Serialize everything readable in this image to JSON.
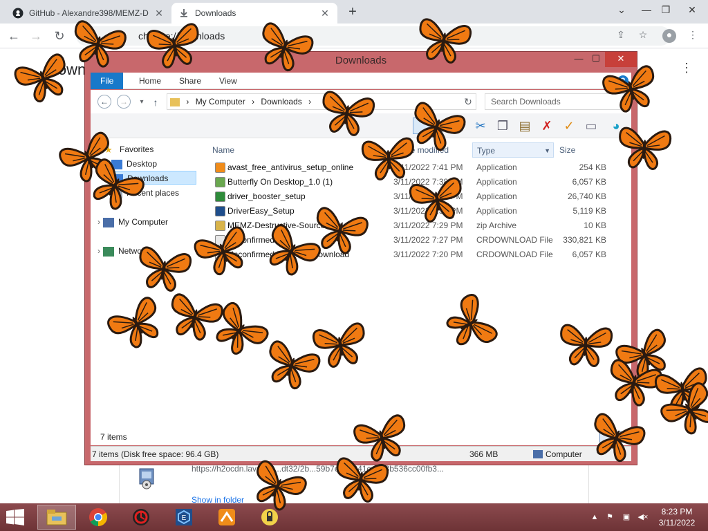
{
  "browser": {
    "tabs": [
      {
        "title": "GitHub - Alexandre398/MEMZ-D",
        "close": "✕",
        "icon": "github-icon"
      },
      {
        "title": "Downloads",
        "close": "✕",
        "icon": "download-icon"
      }
    ],
    "new_tab": "+",
    "window_controls": {
      "chevron": "⌄",
      "minimize": "—",
      "restore": "❐",
      "close": "✕"
    },
    "omnibox_text": "chrome://downloads",
    "page_title": "Downloads",
    "download_item": {
      "url": "https://h2ocdn.lavasoft...dt32/2b...59b7e7d2041ce9e3b536cc00fb3...",
      "action": "Show in folder"
    }
  },
  "explorer": {
    "title": "Downloads",
    "controls": {
      "minimize": "—",
      "maximize": "☐",
      "close": "✕"
    },
    "ribbon_tabs": [
      "File",
      "Home",
      "Share",
      "View"
    ],
    "help": "?",
    "breadcrumb": [
      "My Computer",
      "Downloads"
    ],
    "search_placeholder": "Search Downloads",
    "nav": {
      "favorites": "Favorites",
      "desktop": "Desktop",
      "downloads": "Downloads",
      "recent": "Recent places",
      "my_computer": "My Computer",
      "network": "Network"
    },
    "columns": {
      "name": "Name",
      "date": "Date modified",
      "type": "Type",
      "size": "Size"
    },
    "files": [
      {
        "name": "avast_free_antivirus_setup_online",
        "date": "3/11/2022 7:41 PM",
        "type": "Application",
        "size": "254 KB",
        "color": "#f08c1a"
      },
      {
        "name": "Butterfly On Desktop_1.0 (1)",
        "date": "3/11/2022 7:38 PM",
        "type": "Application",
        "size": "6,057 KB",
        "color": "#6aa84f"
      },
      {
        "name": "driver_booster_setup",
        "date": "3/11/2022 7:33 PM",
        "type": "Application",
        "size": "26,740 KB",
        "color": "#2e8b3a"
      },
      {
        "name": "DriverEasy_Setup",
        "date": "3/11/2022 7:33 PM",
        "type": "Application",
        "size": "5,119 KB",
        "color": "#1f4e8c"
      },
      {
        "name": "MEMZ-Destructive-Source-Code",
        "date": "3/11/2022 7:29 PM",
        "type": "zip Archive",
        "size": "10 KB",
        "color": "#d9b44a"
      },
      {
        "name": "Unconfirmed 3",
        "date": "3/11/2022 7:27 PM",
        "type": "CRDOWNLOAD File",
        "size": "330,821 KB",
        "color": "#e8e8e8"
      },
      {
        "name": "Unconfirmed 780269.crdownload",
        "date": "3/11/2022 7:20 PM",
        "type": "CRDOWNLOAD File",
        "size": "6,057 KB",
        "color": "#e8e8e8"
      }
    ],
    "item_count": "7 items",
    "status_detail": "7 items (Disk free space: 96.4 GB)",
    "status_size": "366 MB",
    "status_location": "Computer"
  },
  "taskbar": {
    "apps": [
      "file-explorer-icon",
      "chrome-icon",
      "driver-booster-icon",
      "driver-easy-icon",
      "avast-icon",
      "memz-icon"
    ],
    "clock_time": "8:23 PM",
    "clock_date": "3/11/2022"
  },
  "overlay": {
    "butterfly_count": 32,
    "wing_color": "#f07a12",
    "vein_color": "#2a1a10"
  }
}
